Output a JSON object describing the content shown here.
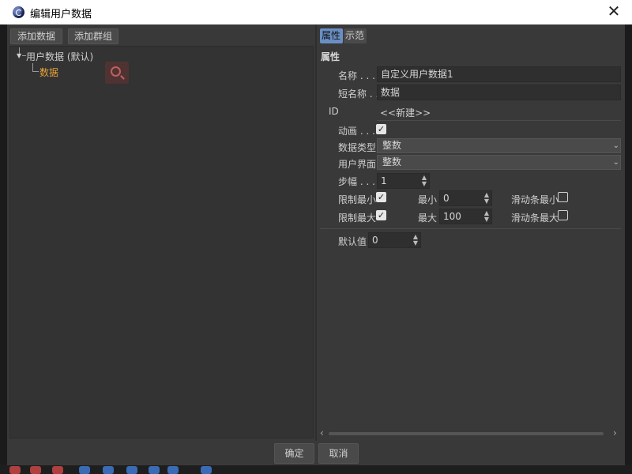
{
  "window": {
    "title": "编辑用户数据"
  },
  "left_panel": {
    "add_data_label": "添加数据",
    "add_group_label": "添加群组",
    "tree": {
      "root_label": "用户数据 (默认)",
      "child_label": "数据"
    }
  },
  "right_panel": {
    "tabs": [
      "属性",
      "示范"
    ],
    "section_title": "属性",
    "name_label": "名称 . . . .",
    "name_value": "自定义用户数据1",
    "short_name_label": "短名称 . .",
    "short_name_value": "数据",
    "id_label": "ID",
    "id_value": "<<新建>>",
    "animate_label": "动画 . . . .",
    "data_type_label": "数据类型",
    "data_type_value": "整数",
    "interface_label": "用户界面",
    "interface_value": "整数",
    "step_label": "步幅 . . . .",
    "step_value": "1",
    "limit_min_label": "限制最小",
    "min_label": "最小",
    "min_value": "0",
    "slider_min_label": "滑动条最小",
    "limit_max_label": "限制最大",
    "max_label": "最大",
    "max_value": "100",
    "slider_max_label": "滑动条最大",
    "default_label": "默认值",
    "default_value": "0",
    "checkboxes": {
      "animate": true,
      "limit_min": true,
      "limit_max": true,
      "slider_min": false,
      "slider_max": false
    }
  },
  "footer": {
    "ok_label": "确定",
    "cancel_label": "取消"
  },
  "colors": {
    "accent_tab": "#6a8fc4",
    "tree_selected_text": "#e8a33a"
  }
}
